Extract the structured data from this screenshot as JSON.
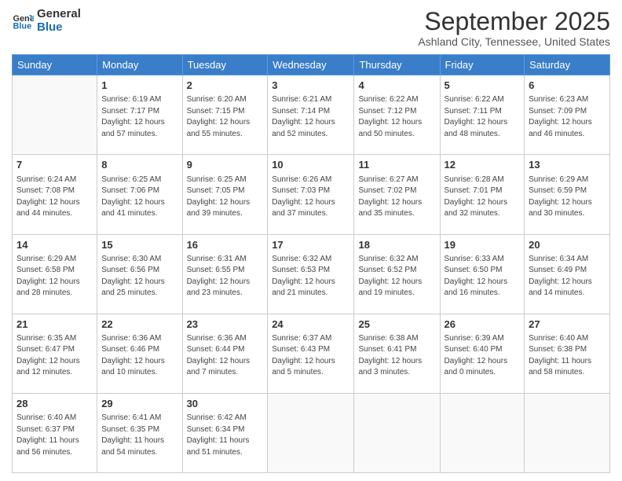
{
  "header": {
    "logo_line1": "General",
    "logo_line2": "Blue",
    "month_title": "September 2025",
    "subtitle": "Ashland City, Tennessee, United States"
  },
  "weekdays": [
    "Sunday",
    "Monday",
    "Tuesday",
    "Wednesday",
    "Thursday",
    "Friday",
    "Saturday"
  ],
  "weeks": [
    [
      {
        "day": "",
        "info": ""
      },
      {
        "day": "1",
        "info": "Sunrise: 6:19 AM\nSunset: 7:17 PM\nDaylight: 12 hours\nand 57 minutes."
      },
      {
        "day": "2",
        "info": "Sunrise: 6:20 AM\nSunset: 7:15 PM\nDaylight: 12 hours\nand 55 minutes."
      },
      {
        "day": "3",
        "info": "Sunrise: 6:21 AM\nSunset: 7:14 PM\nDaylight: 12 hours\nand 52 minutes."
      },
      {
        "day": "4",
        "info": "Sunrise: 6:22 AM\nSunset: 7:12 PM\nDaylight: 12 hours\nand 50 minutes."
      },
      {
        "day": "5",
        "info": "Sunrise: 6:22 AM\nSunset: 7:11 PM\nDaylight: 12 hours\nand 48 minutes."
      },
      {
        "day": "6",
        "info": "Sunrise: 6:23 AM\nSunset: 7:09 PM\nDaylight: 12 hours\nand 46 minutes."
      }
    ],
    [
      {
        "day": "7",
        "info": "Sunrise: 6:24 AM\nSunset: 7:08 PM\nDaylight: 12 hours\nand 44 minutes."
      },
      {
        "day": "8",
        "info": "Sunrise: 6:25 AM\nSunset: 7:06 PM\nDaylight: 12 hours\nand 41 minutes."
      },
      {
        "day": "9",
        "info": "Sunrise: 6:25 AM\nSunset: 7:05 PM\nDaylight: 12 hours\nand 39 minutes."
      },
      {
        "day": "10",
        "info": "Sunrise: 6:26 AM\nSunset: 7:03 PM\nDaylight: 12 hours\nand 37 minutes."
      },
      {
        "day": "11",
        "info": "Sunrise: 6:27 AM\nSunset: 7:02 PM\nDaylight: 12 hours\nand 35 minutes."
      },
      {
        "day": "12",
        "info": "Sunrise: 6:28 AM\nSunset: 7:01 PM\nDaylight: 12 hours\nand 32 minutes."
      },
      {
        "day": "13",
        "info": "Sunrise: 6:29 AM\nSunset: 6:59 PM\nDaylight: 12 hours\nand 30 minutes."
      }
    ],
    [
      {
        "day": "14",
        "info": "Sunrise: 6:29 AM\nSunset: 6:58 PM\nDaylight: 12 hours\nand 28 minutes."
      },
      {
        "day": "15",
        "info": "Sunrise: 6:30 AM\nSunset: 6:56 PM\nDaylight: 12 hours\nand 25 minutes."
      },
      {
        "day": "16",
        "info": "Sunrise: 6:31 AM\nSunset: 6:55 PM\nDaylight: 12 hours\nand 23 minutes."
      },
      {
        "day": "17",
        "info": "Sunrise: 6:32 AM\nSunset: 6:53 PM\nDaylight: 12 hours\nand 21 minutes."
      },
      {
        "day": "18",
        "info": "Sunrise: 6:32 AM\nSunset: 6:52 PM\nDaylight: 12 hours\nand 19 minutes."
      },
      {
        "day": "19",
        "info": "Sunrise: 6:33 AM\nSunset: 6:50 PM\nDaylight: 12 hours\nand 16 minutes."
      },
      {
        "day": "20",
        "info": "Sunrise: 6:34 AM\nSunset: 6:49 PM\nDaylight: 12 hours\nand 14 minutes."
      }
    ],
    [
      {
        "day": "21",
        "info": "Sunrise: 6:35 AM\nSunset: 6:47 PM\nDaylight: 12 hours\nand 12 minutes."
      },
      {
        "day": "22",
        "info": "Sunrise: 6:36 AM\nSunset: 6:46 PM\nDaylight: 12 hours\nand 10 minutes."
      },
      {
        "day": "23",
        "info": "Sunrise: 6:36 AM\nSunset: 6:44 PM\nDaylight: 12 hours\nand 7 minutes."
      },
      {
        "day": "24",
        "info": "Sunrise: 6:37 AM\nSunset: 6:43 PM\nDaylight: 12 hours\nand 5 minutes."
      },
      {
        "day": "25",
        "info": "Sunrise: 6:38 AM\nSunset: 6:41 PM\nDaylight: 12 hours\nand 3 minutes."
      },
      {
        "day": "26",
        "info": "Sunrise: 6:39 AM\nSunset: 6:40 PM\nDaylight: 12 hours\nand 0 minutes."
      },
      {
        "day": "27",
        "info": "Sunrise: 6:40 AM\nSunset: 6:38 PM\nDaylight: 11 hours\nand 58 minutes."
      }
    ],
    [
      {
        "day": "28",
        "info": "Sunrise: 6:40 AM\nSunset: 6:37 PM\nDaylight: 11 hours\nand 56 minutes."
      },
      {
        "day": "29",
        "info": "Sunrise: 6:41 AM\nSunset: 6:35 PM\nDaylight: 11 hours\nand 54 minutes."
      },
      {
        "day": "30",
        "info": "Sunrise: 6:42 AM\nSunset: 6:34 PM\nDaylight: 11 hours\nand 51 minutes."
      },
      {
        "day": "",
        "info": ""
      },
      {
        "day": "",
        "info": ""
      },
      {
        "day": "",
        "info": ""
      },
      {
        "day": "",
        "info": ""
      }
    ]
  ]
}
